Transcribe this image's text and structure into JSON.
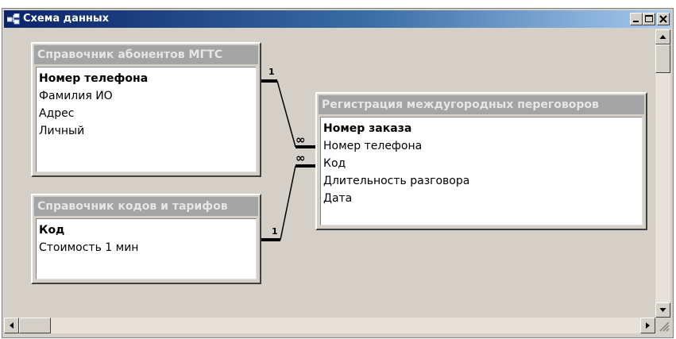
{
  "window": {
    "title": "Схема данных"
  },
  "tables": [
    {
      "title": "Справочник абонентов МГТС",
      "fields": [
        {
          "name": "Номер телефона",
          "key": true
        },
        {
          "name": "Фамилия ИО",
          "key": false
        },
        {
          "name": "Адрес",
          "key": false
        },
        {
          "name": "Личный",
          "key": false
        }
      ]
    },
    {
      "title": "Справочник кодов и тарифов",
      "fields": [
        {
          "name": "Код",
          "key": true
        },
        {
          "name": "Стоимость 1 мин",
          "key": false
        }
      ]
    },
    {
      "title": "Регистрация междугородных переговоров",
      "fields": [
        {
          "name": "Номер заказа",
          "key": true
        },
        {
          "name": "Номер телефона",
          "key": false
        },
        {
          "name": "Код",
          "key": false
        },
        {
          "name": "Длительность разговора",
          "key": false
        },
        {
          "name": "Дата",
          "key": false
        }
      ]
    }
  ],
  "relations": [
    {
      "one_label": "1",
      "many_label": "∞"
    },
    {
      "one_label": "1",
      "many_label": "∞"
    }
  ],
  "colors": {
    "titlebar_start": "#0a246a",
    "titlebar_end": "#a6caf0",
    "table_header": "#a4a4a4",
    "window_bg": "#d4d0c8"
  },
  "icons": {
    "app": "relationship-schema-icon",
    "minimize": "minimize-icon",
    "maximize": "maximize-icon",
    "close": "close-icon"
  }
}
